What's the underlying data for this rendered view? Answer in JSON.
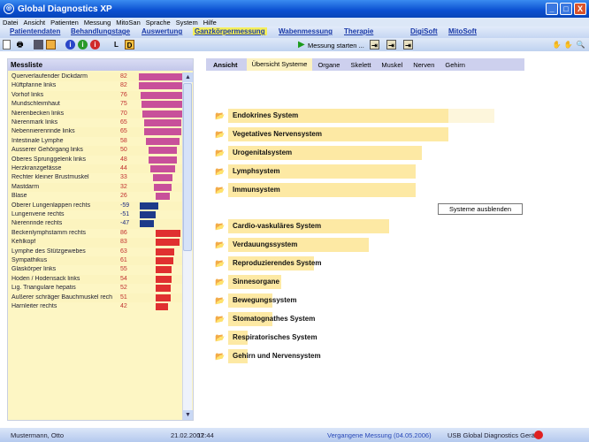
{
  "window": {
    "title": "Global Diagnostics XP",
    "buttons": [
      "_",
      "□",
      "X"
    ]
  },
  "menu": [
    "Datei",
    "Ansicht",
    "Patienten",
    "Messung",
    "MitoSan",
    "Sprache",
    "System",
    "Hilfe"
  ],
  "nav": [
    "Patientendaten",
    "Behandlungstage",
    "Auswertung",
    "Ganzkörpermessung",
    "Wabenmessung",
    "Therapie",
    "DigiSoft",
    "MitoSoft"
  ],
  "nav_active": "Ganzkörpermessung",
  "toolbar": {
    "start_label": "Messung starten ...",
    "l_label": "L",
    "d_label": "D",
    "info_colors": [
      "#2a46c8",
      "#2a9a2a",
      "#d02a2a"
    ]
  },
  "messliste": {
    "title": "Messliste",
    "colors": {
      "positive": "#c8509a",
      "negative": "#1e3a8a",
      "high": "#e03030"
    },
    "rows": [
      {
        "name": "Querverlaufender Dickdarm",
        "value": 82,
        "type": "positive"
      },
      {
        "name": "Hüftpfanne links",
        "value": 82,
        "type": "positive"
      },
      {
        "name": "Vorhof links",
        "value": 76,
        "type": "positive"
      },
      {
        "name": "Mundschleimhaut",
        "value": 75,
        "type": "positive"
      },
      {
        "name": "Nierenbecken links",
        "value": 70,
        "type": "positive"
      },
      {
        "name": "Nierenmark links",
        "value": 65,
        "type": "positive"
      },
      {
        "name": "Nebennierenrinde links",
        "value": 65,
        "type": "positive"
      },
      {
        "name": "Intestinale Lymphe",
        "value": 58,
        "type": "positive"
      },
      {
        "name": "Äusserer Gehörgang links",
        "value": 50,
        "type": "positive"
      },
      {
        "name": "Oberes Sprunggelenk links",
        "value": 48,
        "type": "positive"
      },
      {
        "name": "Herzkranzgefässe",
        "value": 44,
        "type": "positive"
      },
      {
        "name": "Rechter kleiner Brustmuskel",
        "value": 33,
        "type": "positive"
      },
      {
        "name": "Mastdarm",
        "value": 32,
        "type": "positive"
      },
      {
        "name": "Blase",
        "value": 26,
        "type": "positive"
      },
      {
        "name": "Oberer Lungenlappen rechts",
        "value": -59,
        "type": "negative"
      },
      {
        "name": "Lungenvene rechts",
        "value": -51,
        "type": "negative"
      },
      {
        "name": "Nierenrinde rechts",
        "value": -47,
        "type": "negative"
      },
      {
        "name": "Beckenlymphstamm rechts",
        "value": 86,
        "type": "high"
      },
      {
        "name": "Kehlkopf",
        "value": 83,
        "type": "high"
      },
      {
        "name": "Lymphe des Stützgewebes",
        "value": 63,
        "type": "high"
      },
      {
        "name": "Sympathikus",
        "value": 61,
        "type": "high"
      },
      {
        "name": "Glaskörper links",
        "value": 55,
        "type": "high"
      },
      {
        "name": "Hoden / Hodensack links",
        "value": 54,
        "type": "high"
      },
      {
        "name": "Lig. Triangulare hepatis",
        "value": 52,
        "type": "high"
      },
      {
        "name": "Äußerer schräger Bauchmuskel rech",
        "value": 51,
        "type": "high"
      },
      {
        "name": "Harnleiter rechts",
        "value": 42,
        "type": "high"
      }
    ]
  },
  "view": {
    "label": "Ansicht",
    "tabs": [
      "Übersicht Systeme",
      "Organe",
      "Skelett",
      "Muskel",
      "Nerven",
      "Gehirn"
    ],
    "active": "Übersicht Systeme"
  },
  "systems_top": [
    {
      "name": "Endokrines System",
      "level": 1.0,
      "extra": 0.21
    },
    {
      "name": "Vegetatives Nervensystem",
      "level": 1.0
    },
    {
      "name": "Urogenitalsystem",
      "level": 0.88
    },
    {
      "name": "Lymphsystem",
      "level": 0.85
    },
    {
      "name": "Immunsystem",
      "level": 0.85
    }
  ],
  "hide_button": "Systeme ausblenden",
  "systems_bottom": [
    {
      "name": "Cardio-vaskuläres System",
      "level": 0.73
    },
    {
      "name": "Verdauungssystem",
      "level": 0.64
    },
    {
      "name": "Reproduzierendes System",
      "level": 0.39
    },
    {
      "name": "Sinnesorgane",
      "level": 0.24
    },
    {
      "name": "Bewegungssystem",
      "level": 0.2
    },
    {
      "name": "Stomatognathes System",
      "level": 0.2
    },
    {
      "name": "Respiratorisches System",
      "level": 0.09
    },
    {
      "name": "Gehirn und Nervensystem",
      "level": 0.09
    }
  ],
  "status": {
    "patient": "Mustermann, Otto",
    "date": "21.02.2007",
    "time": "12:44",
    "measurement": "Vergangene Messung (04.05.2006)",
    "device": "USB Global Diagnostics Gerät"
  }
}
